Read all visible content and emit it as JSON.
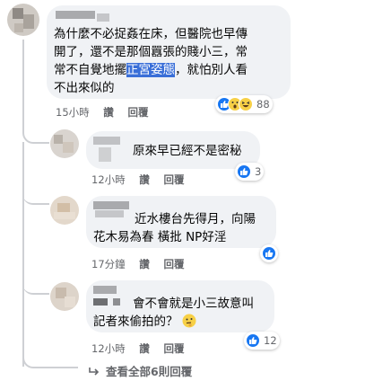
{
  "comments": [
    {
      "lines": [
        "為什麼不必捉姦在床，但醫院也早傳",
        "開了，還不是那個囂張的賤小三，常",
        "常不自覺地擺",
        "，就怕別人看",
        "不出來似的"
      ],
      "highlight": "正宮姿態",
      "time": "15小時",
      "like": "讚",
      "reply": "回覆",
      "reactions": "88"
    },
    {
      "text": "原來早已經不是密秘",
      "time": "12小時",
      "like": "讚",
      "reply": "回覆",
      "reactions": "3"
    },
    {
      "lines": [
        "近水樓台先得月，向陽",
        "花木易為春 橫批 NP好淫"
      ],
      "time": "17分鐘",
      "like": "讚",
      "reply": "回覆",
      "reactions": ""
    },
    {
      "lines": [
        "會不會就是小三故意叫",
        "記者來偷拍的？"
      ],
      "time": "12小時",
      "like": "讚",
      "reply": "回覆",
      "reactions": "12"
    }
  ],
  "view_more": "查看全部6則回覆",
  "colors": {
    "like_blue": "#1877f2",
    "highlight": "#3a6fd8",
    "bubble": "#f0f2f5",
    "meta_gray": "#65676b"
  }
}
